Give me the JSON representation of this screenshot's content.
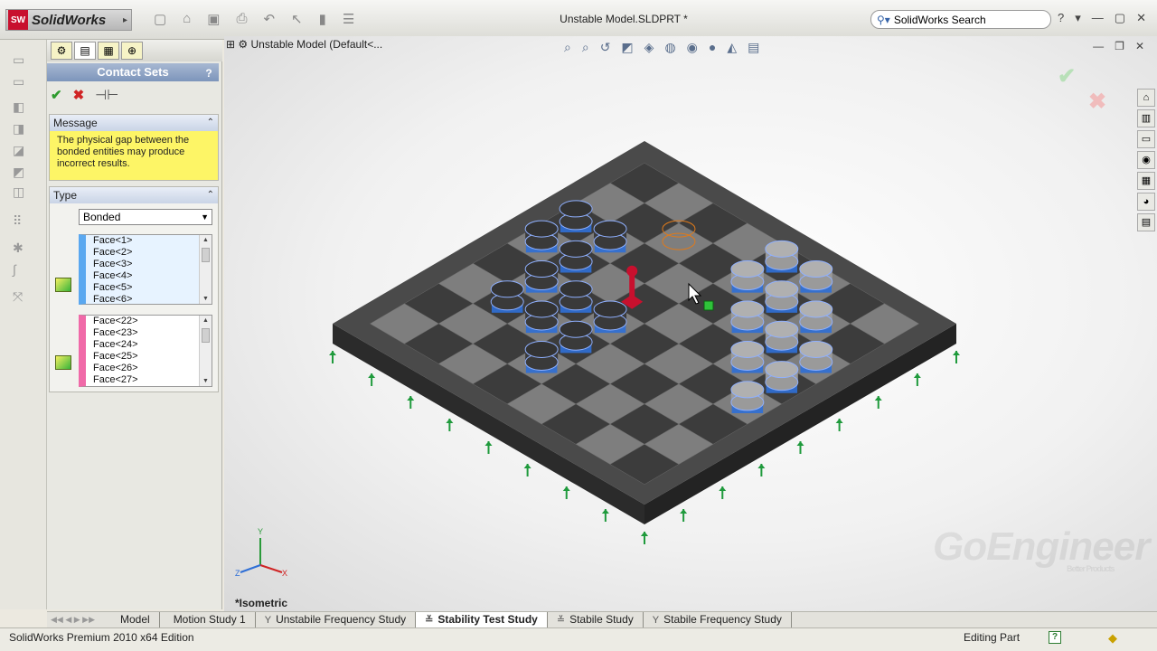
{
  "app": {
    "logo_text": "SolidWorks",
    "logo_mark": "SW",
    "document_title": "Unstable Model.SLDPRT *",
    "search_placeholder": "SolidWorks Search"
  },
  "property_manager": {
    "title": "Contact Sets",
    "help": "?",
    "message_group": {
      "title": "Message",
      "text": "The physical gap between the bonded entities may produce incorrect results."
    },
    "type_group": {
      "title": "Type",
      "selected_type": "Bonded",
      "set1_faces": [
        "Face<1>",
        "Face<2>",
        "Face<3>",
        "Face<4>",
        "Face<5>",
        "Face<6>"
      ],
      "set2_faces": [
        "Face<22>",
        "Face<23>",
        "Face<24>",
        "Face<25>",
        "Face<26>",
        "Face<27>"
      ]
    }
  },
  "graphics": {
    "tree_label": "Unstable Model  (Default<...",
    "view_name": "*Isometric",
    "watermark": "GoEngineer",
    "watermark_sub": "Better Products",
    "triad": {
      "x": "X",
      "y": "Y",
      "z": "Z"
    }
  },
  "bottom_tabs": [
    {
      "label": "Model",
      "icon": "",
      "active": false
    },
    {
      "label": "Motion Study 1",
      "icon": "",
      "active": false
    },
    {
      "label": "Unstabile Frequency Study",
      "icon": "Y",
      "active": false
    },
    {
      "label": "Stability Test Study",
      "icon": "≚",
      "active": true
    },
    {
      "label": "Stabile Study",
      "icon": "≚",
      "active": false
    },
    {
      "label": "Stabile Frequency Study",
      "icon": "Y",
      "active": false
    }
  ],
  "status": {
    "left": "SolidWorks Premium 2010 x64 Edition",
    "mode": "Editing Part"
  },
  "colors": {
    "accent_blue": "#2f6fd6",
    "board_dark": "#3c3c3c",
    "board_light": "#7e7e7e",
    "highlight_orange": "#e07a1a",
    "pawn_red": "#c8102e",
    "fixture_green": "#1f9a3c"
  }
}
